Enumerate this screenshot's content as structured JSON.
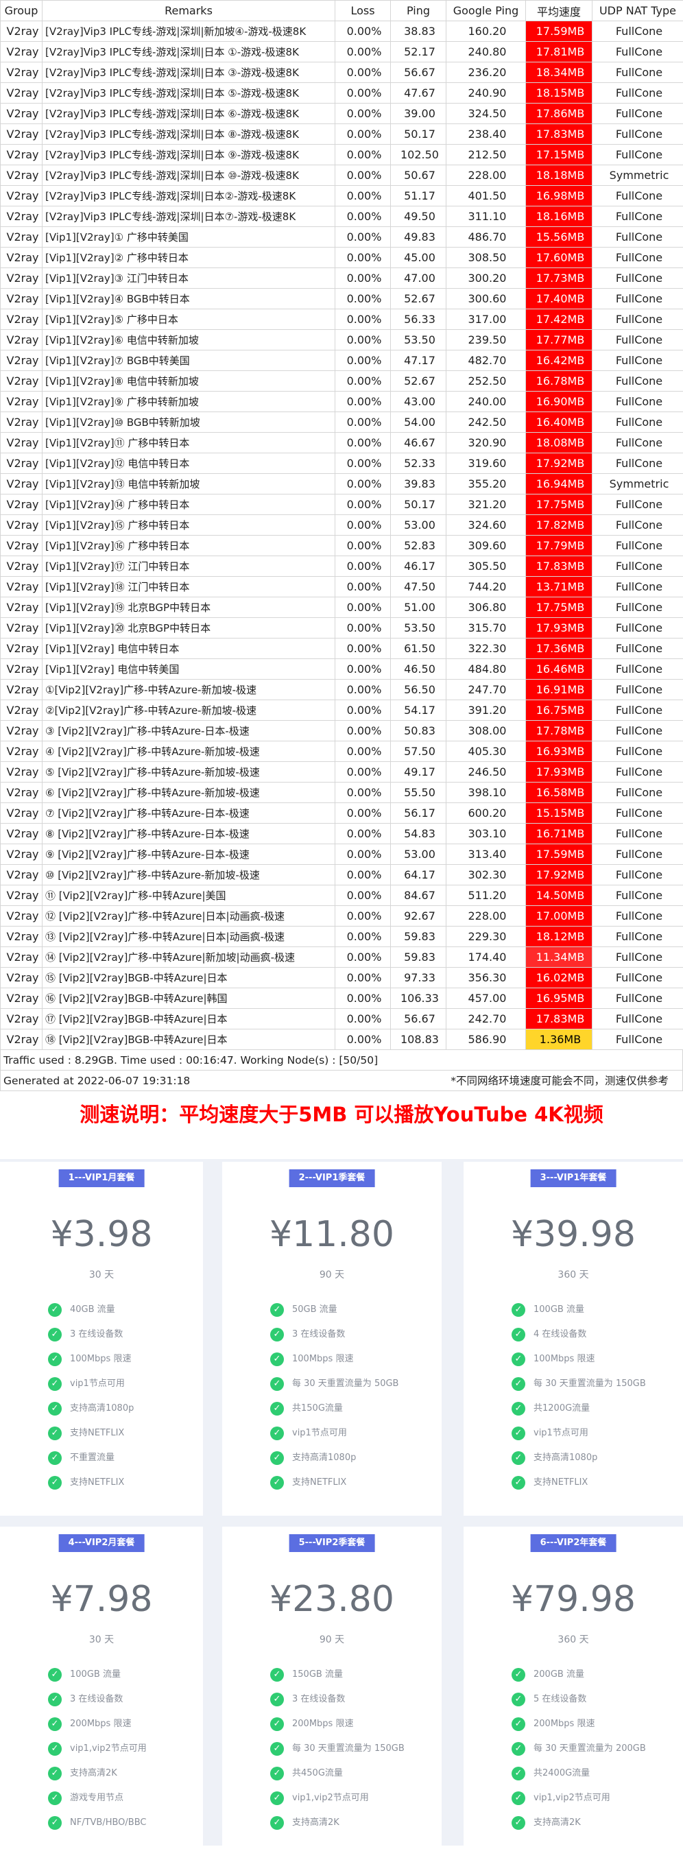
{
  "colors": {
    "red": "#ff0000",
    "red_soft": "#ff2a2a",
    "yellow": "#ffd52a",
    "check": "#2ecc71",
    "tag": "#5b6ee1"
  },
  "table": {
    "headers": [
      "Group",
      "Remarks",
      "Loss",
      "Ping",
      "Google Ping",
      "平均速度",
      "UDP NAT Type"
    ],
    "rows": [
      {
        "group": "V2ray",
        "remarks": "[V2ray]Vip3 IPLC专线-游戏|深圳|新加坡④-游戏-极速8K",
        "loss": "0.00%",
        "ping": "38.83",
        "gping": "160.20",
        "speed": "17.59MB",
        "nat": "FullCone",
        "color": "red"
      },
      {
        "group": "V2ray",
        "remarks": "[V2ray]Vip3 IPLC专线-游戏|深圳|日本 ①-游戏-极速8K",
        "loss": "0.00%",
        "ping": "52.17",
        "gping": "240.80",
        "speed": "17.81MB",
        "nat": "FullCone",
        "color": "red"
      },
      {
        "group": "V2ray",
        "remarks": "[V2ray]Vip3 IPLC专线-游戏|深圳|日本 ③-游戏-极速8K",
        "loss": "0.00%",
        "ping": "56.67",
        "gping": "236.20",
        "speed": "18.34MB",
        "nat": "FullCone",
        "color": "red"
      },
      {
        "group": "V2ray",
        "remarks": "[V2ray]Vip3 IPLC专线-游戏|深圳|日本 ⑤-游戏-极速8K",
        "loss": "0.00%",
        "ping": "47.67",
        "gping": "240.90",
        "speed": "18.15MB",
        "nat": "FullCone",
        "color": "red"
      },
      {
        "group": "V2ray",
        "remarks": "[V2ray]Vip3 IPLC专线-游戏|深圳|日本 ⑥-游戏-极速8K",
        "loss": "0.00%",
        "ping": "39.00",
        "gping": "324.50",
        "speed": "17.86MB",
        "nat": "FullCone",
        "color": "red"
      },
      {
        "group": "V2ray",
        "remarks": "[V2ray]Vip3 IPLC专线-游戏|深圳|日本 ⑧-游戏-极速8K",
        "loss": "0.00%",
        "ping": "50.17",
        "gping": "238.40",
        "speed": "17.83MB",
        "nat": "FullCone",
        "color": "red"
      },
      {
        "group": "V2ray",
        "remarks": "[V2ray]Vip3 IPLC专线-游戏|深圳|日本 ⑨-游戏-极速8K",
        "loss": "0.00%",
        "ping": "102.50",
        "gping": "212.50",
        "speed": "17.15MB",
        "nat": "FullCone",
        "color": "red"
      },
      {
        "group": "V2ray",
        "remarks": "[V2ray]Vip3 IPLC专线-游戏|深圳|日本 ⑩-游戏-极速8K",
        "loss": "0.00%",
        "ping": "50.67",
        "gping": "228.00",
        "speed": "18.18MB",
        "nat": "Symmetric",
        "color": "red"
      },
      {
        "group": "V2ray",
        "remarks": "[V2ray]Vip3 IPLC专线-游戏|深圳|日本②-游戏-极速8K",
        "loss": "0.00%",
        "ping": "51.17",
        "gping": "401.50",
        "speed": "16.98MB",
        "nat": "FullCone",
        "color": "red"
      },
      {
        "group": "V2ray",
        "remarks": "[V2ray]Vip3 IPLC专线-游戏|深圳|日本⑦-游戏-极速8K",
        "loss": "0.00%",
        "ping": "49.50",
        "gping": "311.10",
        "speed": "18.16MB",
        "nat": "FullCone",
        "color": "red"
      },
      {
        "group": "V2ray",
        "remarks": "[Vip1][V2ray]① 广移中转美国",
        "loss": "0.00%",
        "ping": "49.83",
        "gping": "486.70",
        "speed": "15.56MB",
        "nat": "FullCone",
        "color": "red"
      },
      {
        "group": "V2ray",
        "remarks": "[Vip1][V2ray]② 广移中转日本",
        "loss": "0.00%",
        "ping": "45.00",
        "gping": "308.50",
        "speed": "17.60MB",
        "nat": "FullCone",
        "color": "red"
      },
      {
        "group": "V2ray",
        "remarks": "[Vip1][V2ray]③ 江门中转日本",
        "loss": "0.00%",
        "ping": "47.00",
        "gping": "300.20",
        "speed": "17.73MB",
        "nat": "FullCone",
        "color": "red"
      },
      {
        "group": "V2ray",
        "remarks": "[Vip1][V2ray]④ BGB中转日本",
        "loss": "0.00%",
        "ping": "52.67",
        "gping": "300.60",
        "speed": "17.40MB",
        "nat": "FullCone",
        "color": "red"
      },
      {
        "group": "V2ray",
        "remarks": "[Vip1][V2ray]⑤ 广移中日本",
        "loss": "0.00%",
        "ping": "56.33",
        "gping": "317.00",
        "speed": "17.42MB",
        "nat": "FullCone",
        "color": "red"
      },
      {
        "group": "V2ray",
        "remarks": "[Vip1][V2ray]⑥ 电信中转新加坡",
        "loss": "0.00%",
        "ping": "53.50",
        "gping": "239.50",
        "speed": "17.77MB",
        "nat": "FullCone",
        "color": "red"
      },
      {
        "group": "V2ray",
        "remarks": "[Vip1][V2ray]⑦ BGB中转美国",
        "loss": "0.00%",
        "ping": "47.17",
        "gping": "482.70",
        "speed": "16.42MB",
        "nat": "FullCone",
        "color": "red"
      },
      {
        "group": "V2ray",
        "remarks": "[Vip1][V2ray]⑧ 电信中转新加坡",
        "loss": "0.00%",
        "ping": "52.67",
        "gping": "252.50",
        "speed": "16.78MB",
        "nat": "FullCone",
        "color": "red"
      },
      {
        "group": "V2ray",
        "remarks": "[Vip1][V2ray]⑨ 广移中转新加坡",
        "loss": "0.00%",
        "ping": "43.00",
        "gping": "240.00",
        "speed": "16.90MB",
        "nat": "FullCone",
        "color": "red"
      },
      {
        "group": "V2ray",
        "remarks": "[Vip1][V2ray]⑩ BGB中转新加坡",
        "loss": "0.00%",
        "ping": "54.00",
        "gping": "242.50",
        "speed": "16.40MB",
        "nat": "FullCone",
        "color": "red"
      },
      {
        "group": "V2ray",
        "remarks": "[Vip1][V2ray]⑪ 广移中转日本",
        "loss": "0.00%",
        "ping": "46.67",
        "gping": "320.90",
        "speed": "18.08MB",
        "nat": "FullCone",
        "color": "red"
      },
      {
        "group": "V2ray",
        "remarks": "[Vip1][V2ray]⑫ 电信中转日本",
        "loss": "0.00%",
        "ping": "52.33",
        "gping": "319.60",
        "speed": "17.92MB",
        "nat": "FullCone",
        "color": "red"
      },
      {
        "group": "V2ray",
        "remarks": "[Vip1][V2ray]⑬ 电信中转新加坡",
        "loss": "0.00%",
        "ping": "39.83",
        "gping": "355.20",
        "speed": "16.94MB",
        "nat": "Symmetric",
        "color": "red"
      },
      {
        "group": "V2ray",
        "remarks": "[Vip1][V2ray]⑭ 广移中转日本",
        "loss": "0.00%",
        "ping": "50.17",
        "gping": "321.20",
        "speed": "17.75MB",
        "nat": "FullCone",
        "color": "red"
      },
      {
        "group": "V2ray",
        "remarks": "[Vip1][V2ray]⑮ 广移中转日本",
        "loss": "0.00%",
        "ping": "53.00",
        "gping": "324.60",
        "speed": "17.82MB",
        "nat": "FullCone",
        "color": "red"
      },
      {
        "group": "V2ray",
        "remarks": "[Vip1][V2ray]⑯ 广移中转日本",
        "loss": "0.00%",
        "ping": "52.83",
        "gping": "309.60",
        "speed": "17.79MB",
        "nat": "FullCone",
        "color": "red"
      },
      {
        "group": "V2ray",
        "remarks": "[Vip1][V2ray]⑰ 江门中转日本",
        "loss": "0.00%",
        "ping": "46.17",
        "gping": "305.50",
        "speed": "17.83MB",
        "nat": "FullCone",
        "color": "red"
      },
      {
        "group": "V2ray",
        "remarks": "[Vip1][V2ray]⑱ 江门中转日本",
        "loss": "0.00%",
        "ping": "47.50",
        "gping": "744.20",
        "speed": "13.71MB",
        "nat": "FullCone",
        "color": "red"
      },
      {
        "group": "V2ray",
        "remarks": "[Vip1][V2ray]⑲ 北京BGP中转日本",
        "loss": "0.00%",
        "ping": "51.00",
        "gping": "306.80",
        "speed": "17.75MB",
        "nat": "FullCone",
        "color": "red"
      },
      {
        "group": "V2ray",
        "remarks": "[Vip1][V2ray]⑳ 北京BGP中转日本",
        "loss": "0.00%",
        "ping": "53.50",
        "gping": "315.70",
        "speed": "17.93MB",
        "nat": "FullCone",
        "color": "red"
      },
      {
        "group": "V2ray",
        "remarks": "[Vip1][V2ray] 电信中转日本",
        "loss": "0.00%",
        "ping": "61.50",
        "gping": "322.30",
        "speed": "17.36MB",
        "nat": "FullCone",
        "color": "red"
      },
      {
        "group": "V2ray",
        "remarks": "[Vip1][V2ray] 电信中转美国",
        "loss": "0.00%",
        "ping": "46.50",
        "gping": "484.80",
        "speed": "16.46MB",
        "nat": "FullCone",
        "color": "red"
      },
      {
        "group": "V2ray",
        "remarks": "①[Vip2][V2ray]广移-中转Azure-新加坡-极速",
        "loss": "0.00%",
        "ping": "56.50",
        "gping": "247.70",
        "speed": "16.91MB",
        "nat": "FullCone",
        "color": "red"
      },
      {
        "group": "V2ray",
        "remarks": "②[Vip2][V2ray]广移-中转Azure-新加坡-极速",
        "loss": "0.00%",
        "ping": "54.17",
        "gping": "391.20",
        "speed": "16.75MB",
        "nat": "FullCone",
        "color": "red"
      },
      {
        "group": "V2ray",
        "remarks": "③ [Vip2][V2ray]广移-中转Azure-日本-极速",
        "loss": "0.00%",
        "ping": "50.83",
        "gping": "308.00",
        "speed": "17.78MB",
        "nat": "FullCone",
        "color": "red"
      },
      {
        "group": "V2ray",
        "remarks": "④ [Vip2][V2ray]广移-中转Azure-新加坡-极速",
        "loss": "0.00%",
        "ping": "57.50",
        "gping": "405.30",
        "speed": "16.93MB",
        "nat": "FullCone",
        "color": "red"
      },
      {
        "group": "V2ray",
        "remarks": "⑤ [Vip2][V2ray]广移-中转Azure-新加坡-极速",
        "loss": "0.00%",
        "ping": "49.17",
        "gping": "246.50",
        "speed": "17.93MB",
        "nat": "FullCone",
        "color": "red"
      },
      {
        "group": "V2ray",
        "remarks": "⑥ [Vip2][V2ray]广移-中转Azure-新加坡-极速",
        "loss": "0.00%",
        "ping": "55.50",
        "gping": "398.10",
        "speed": "16.58MB",
        "nat": "FullCone",
        "color": "red"
      },
      {
        "group": "V2ray",
        "remarks": "⑦ [Vip2][V2ray]广移-中转Azure-日本-极速",
        "loss": "0.00%",
        "ping": "56.17",
        "gping": "600.20",
        "speed": "15.15MB",
        "nat": "FullCone",
        "color": "red"
      },
      {
        "group": "V2ray",
        "remarks": "⑧ [Vip2][V2ray]广移-中转Azure-日本-极速",
        "loss": "0.00%",
        "ping": "54.83",
        "gping": "303.10",
        "speed": "16.71MB",
        "nat": "FullCone",
        "color": "red"
      },
      {
        "group": "V2ray",
        "remarks": "⑨ [Vip2][V2ray]广移-中转Azure-日本-极速",
        "loss": "0.00%",
        "ping": "53.00",
        "gping": "313.40",
        "speed": "17.59MB",
        "nat": "FullCone",
        "color": "red"
      },
      {
        "group": "V2ray",
        "remarks": "⑩ [Vip2][V2ray]广移-中转Azure-新加坡-极速",
        "loss": "0.00%",
        "ping": "64.17",
        "gping": "302.30",
        "speed": "17.92MB",
        "nat": "FullCone",
        "color": "red"
      },
      {
        "group": "V2ray",
        "remarks": "⑪ [Vip2][V2ray]广移-中转Azure|美国",
        "loss": "0.00%",
        "ping": "84.67",
        "gping": "511.20",
        "speed": "14.50MB",
        "nat": "FullCone",
        "color": "red"
      },
      {
        "group": "V2ray",
        "remarks": "⑫ [Vip2][V2ray]广移-中转Azure|日本|动画疯-极速",
        "loss": "0.00%",
        "ping": "92.67",
        "gping": "228.00",
        "speed": "17.00MB",
        "nat": "FullCone",
        "color": "red"
      },
      {
        "group": "V2ray",
        "remarks": "⑬ [Vip2][V2ray]广移-中转Azure|日本|动画疯-极速",
        "loss": "0.00%",
        "ping": "59.83",
        "gping": "229.30",
        "speed": "18.12MB",
        "nat": "FullCone",
        "color": "red"
      },
      {
        "group": "V2ray",
        "remarks": "⑭ [Vip2][V2ray]广移-中转Azure|新加坡|动画疯-极速",
        "loss": "0.00%",
        "ping": "59.83",
        "gping": "174.40",
        "speed": "11.34MB",
        "nat": "FullCone",
        "color": "red_soft"
      },
      {
        "group": "V2ray",
        "remarks": "⑮ [Vip2][V2ray]BGB-中转Azure|日本",
        "loss": "0.00%",
        "ping": "97.33",
        "gping": "356.30",
        "speed": "16.02MB",
        "nat": "FullCone",
        "color": "red"
      },
      {
        "group": "V2ray",
        "remarks": "⑯ [Vip2][V2ray]BGB-中转Azure|韩国",
        "loss": "0.00%",
        "ping": "106.33",
        "gping": "457.00",
        "speed": "16.95MB",
        "nat": "FullCone",
        "color": "red"
      },
      {
        "group": "V2ray",
        "remarks": "⑰ [Vip2][V2ray]BGB-中转Azure|日本",
        "loss": "0.00%",
        "ping": "56.67",
        "gping": "242.70",
        "speed": "17.83MB",
        "nat": "FullCone",
        "color": "red"
      },
      {
        "group": "V2ray",
        "remarks": "⑱ [Vip2][V2ray]BGB-中转Azure|日本",
        "loss": "0.00%",
        "ping": "108.83",
        "gping": "586.90",
        "speed": "1.36MB",
        "nat": "FullCone",
        "color": "yellow"
      }
    ],
    "traffic": "Traffic used : 8.29GB. Time used : 00:16:47. Working Node(s) : [50/50]",
    "generated": "Generated at 2022-06-07 19:31:18",
    "note": "*不同网络环境速度可能会不同，测速仅供参考"
  },
  "announcement": "测速说明：平均速度大于5MB 可以播放YouTube 4K视频",
  "plans": [
    {
      "tag": "1---VIP1月套餐",
      "price": "¥3.98",
      "period": "30 天",
      "features": [
        "40GB 流量",
        "3 在线设备数",
        "100Mbps 限速",
        "vip1节点可用",
        "支持高清1080p",
        "支持NETFLIX",
        "不重置流量",
        "支持NETFLIX"
      ]
    },
    {
      "tag": "2---VIP1季套餐",
      "price": "¥11.80",
      "period": "90 天",
      "features": [
        "50GB 流量",
        "3 在线设备数",
        "100Mbps 限速",
        "每 30 天重置流量为 50GB",
        "共150G流量",
        "vip1节点可用",
        "支持高清1080p",
        "支持NETFLIX"
      ]
    },
    {
      "tag": "3---VIP1年套餐",
      "price": "¥39.98",
      "period": "360 天",
      "features": [
        "100GB 流量",
        "4 在线设备数",
        "100Mbps 限速",
        "每 30 天重置流量为 150GB",
        "共1200G流量",
        "vip1节点可用",
        "支持高清1080p",
        "支持NETFLIX"
      ]
    },
    {
      "tag": "4---VIP2月套餐",
      "price": "¥7.98",
      "period": "30 天",
      "features": [
        "100GB 流量",
        "3 在线设备数",
        "200Mbps 限速",
        "vip1,vip2节点可用",
        "支持高清2K",
        "游戏专用节点",
        "NF/TVB/HBO/BBC"
      ]
    },
    {
      "tag": "5---VIP2季套餐",
      "price": "¥23.80",
      "period": "90 天",
      "features": [
        "150GB 流量",
        "3 在线设备数",
        "200Mbps 限速",
        "每 30 天重置流量为 150GB",
        "共450G流量",
        "vip1,vip2节点可用",
        "支持高清2K"
      ]
    },
    {
      "tag": "6---VIP2年套餐",
      "price": "¥79.98",
      "period": "360 天",
      "features": [
        "200GB 流量",
        "5 在线设备数",
        "200Mbps 限速",
        "每 30 天重置流量为 200GB",
        "共2400G流量",
        "vip1,vip2节点可用",
        "支持高清2K"
      ]
    }
  ]
}
